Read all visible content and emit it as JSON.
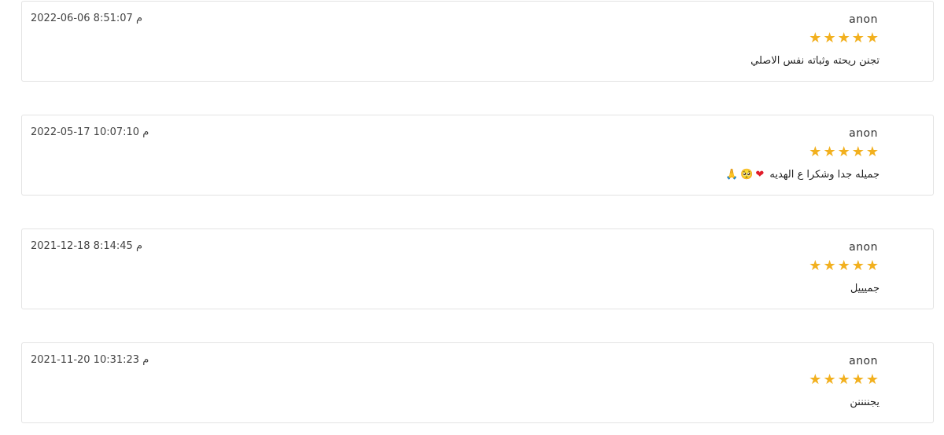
{
  "reviews": [
    {
      "author": "anon",
      "date": "2022-06-06 8:51:07 م",
      "rating": 5,
      "text": "تجنن ريحته وثباته نفس الاصلي",
      "emojis": []
    },
    {
      "author": "anon",
      "date": "2022-05-17 10:07:10 م",
      "rating": 5,
      "text": "جميله جدا وشكرا ع الهديه",
      "emojis": [
        "❤",
        "🥺",
        "🙏"
      ]
    },
    {
      "author": "anon",
      "date": "2021-12-18 8:14:45 م",
      "rating": 5,
      "text": "جميييل",
      "emojis": []
    },
    {
      "author": "anon",
      "date": "2021-11-20 10:31:23 م",
      "rating": 5,
      "text": "يجننننن",
      "emojis": []
    }
  ],
  "colors": {
    "star": "#f2b01e",
    "border": "#e3e3e3"
  },
  "icons": {
    "star": "star-icon"
  }
}
